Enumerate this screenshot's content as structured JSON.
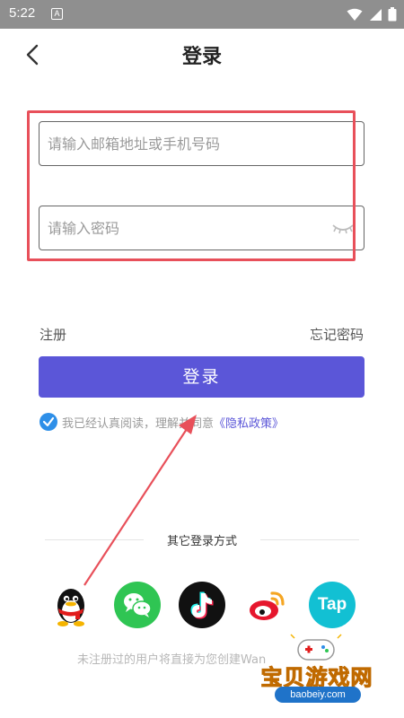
{
  "status_bar": {
    "time": "5:22",
    "notification_letter": "A"
  },
  "header": {
    "title": "登录"
  },
  "form": {
    "email_placeholder": "请输入邮箱地址或手机号码",
    "email_value": "",
    "password_placeholder": "请输入密码",
    "password_value": ""
  },
  "links": {
    "register": "注册",
    "forgot_password": "忘记密码"
  },
  "login_button": "登录",
  "agreement": {
    "checked": true,
    "text": "我已经认真阅读，理解并同意",
    "policy_link": "《隐私政策》"
  },
  "other_login": {
    "title": "其它登录方式",
    "providers": [
      {
        "name": "qq-icon"
      },
      {
        "name": "wechat-icon"
      },
      {
        "name": "tiktok-icon"
      },
      {
        "name": "weibo-icon"
      },
      {
        "name": "taptap-icon",
        "label": "Tap"
      }
    ]
  },
  "footer_note": "未注册过的用户将直接为您创建Wan",
  "watermark": {
    "text": "宝贝游戏网",
    "url": "baobeiy.com"
  },
  "colors": {
    "accent": "#5b56d8",
    "checkbox": "#2e8fe8",
    "annotation": "#e8505a"
  }
}
